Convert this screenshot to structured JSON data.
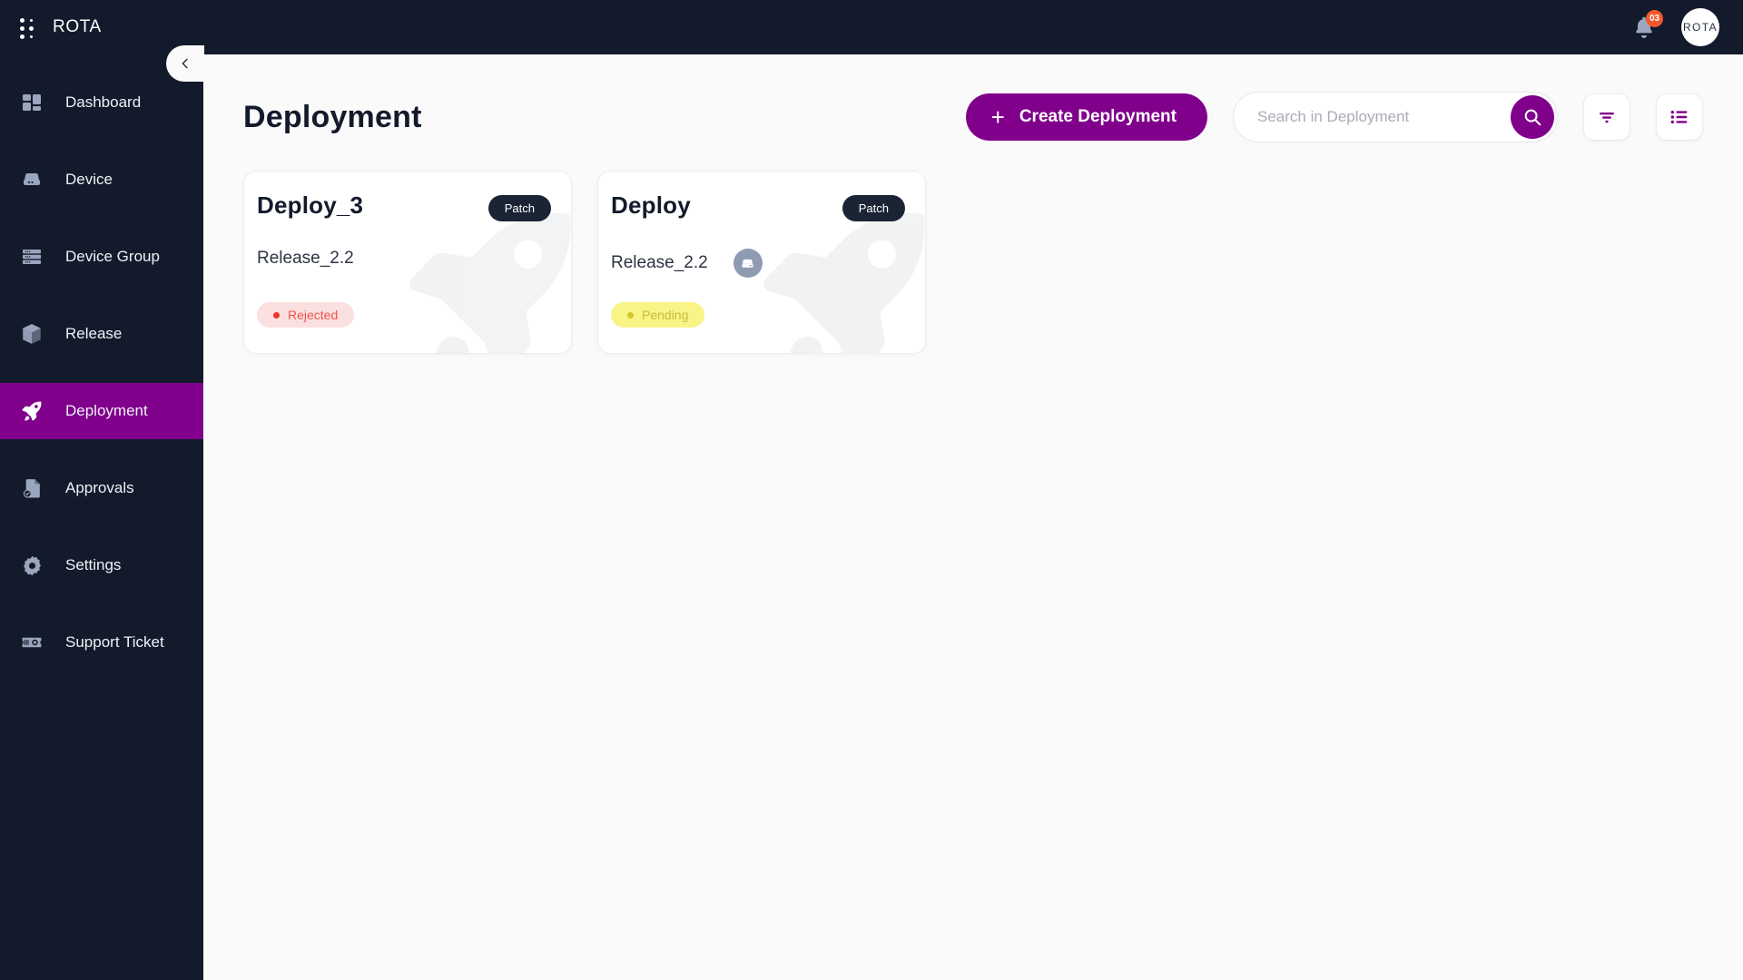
{
  "topbar": {
    "brand": "ROTA",
    "menu_icon": "grid-dots-icon",
    "notification_icon": "bell-icon",
    "notification_count": "03",
    "avatar_label": "ROTA"
  },
  "sidebar": {
    "collapse_icon": "chevron-left-icon",
    "items": [
      {
        "label": "Dashboard",
        "icon": "dashboard-icon",
        "active": false
      },
      {
        "label": "Device",
        "icon": "device-icon",
        "active": false
      },
      {
        "label": "Device Group",
        "icon": "device-group-icon",
        "active": false
      },
      {
        "label": "Release",
        "icon": "release-box-icon",
        "active": false
      },
      {
        "label": "Deployment",
        "icon": "rocket-icon",
        "active": true
      },
      {
        "label": "Approvals",
        "icon": "approvals-icon",
        "active": false
      },
      {
        "label": "Settings",
        "icon": "gear-icon",
        "active": false
      },
      {
        "label": "Support Ticket",
        "icon": "ticket-icon",
        "active": false
      }
    ]
  },
  "header": {
    "title": "Deployment",
    "create_button": "Create Deployment",
    "create_icon": "plus-icon",
    "search_placeholder": "Search in Deployment",
    "search_value": "",
    "search_icon": "search-icon",
    "filter_icon": "filter-icon",
    "list_view_icon": "list-view-icon"
  },
  "cards": [
    {
      "title": "Deploy_3",
      "type_badge": "Patch",
      "release": "Release_2.2",
      "status": "Rejected",
      "status_style": "status-rejected",
      "has_device": false,
      "device_icon": "device-icon"
    },
    {
      "title": "Deploy",
      "type_badge": "Patch",
      "release": "Release_2.2",
      "status": "Pending",
      "status_style": "status-pending",
      "has_device": true,
      "device_icon": "device-icon"
    }
  ],
  "colors": {
    "brand_purple": "#80008c",
    "sidebar_dark": "#131a2b",
    "badge_orange": "#f4572b",
    "rejected": "#f0544f",
    "pending": "#c9bf3c"
  }
}
